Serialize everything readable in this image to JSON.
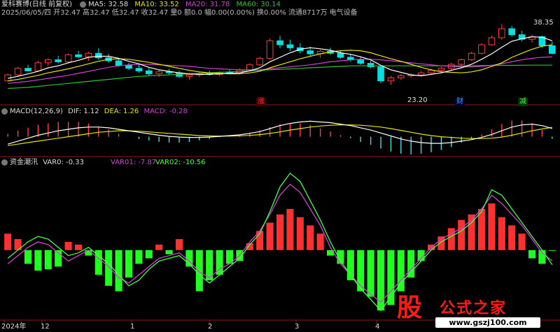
{
  "header": {
    "title": "爱科赛博(日线 前复权)",
    "ma5": "MA5: 32.58",
    "ma10": "MA10: 33.52",
    "ma20": "MA20: 31.78",
    "ma60": "MA60: 30.14",
    "info": "2025/06/05/四 开32.47 高32.47 低32.47 收32.47 量0 额0.0 幅0.00(0.00%) 换0.00% 流通8717万 电气设备"
  },
  "macd": {
    "title": "MACD(12,26,9)",
    "dif": "DIF: 1.12",
    "dea": "DEA: 1.26",
    "macd": "MACD: -0.28"
  },
  "fund": {
    "title": "资金潮汛",
    "var0": "VAR0: -0.33",
    "var01": "VAR01: -7.87",
    "var02": "VAR02: -10.56"
  },
  "markers": {
    "high": "38.35",
    "low": "23.20",
    "zhang": "涨",
    "cai": "财",
    "jian": "减"
  },
  "x_axis": [
    "2024年",
    "12",
    "1",
    "2",
    "3",
    "4"
  ],
  "logo": {
    "glyph": "股",
    "brand": "公式之家",
    "url": "www.gszj100.com"
  },
  "colors": {
    "up": "#ff3c3c",
    "down": "#00e0e0",
    "ma5": "#ffffff",
    "ma10": "#e6e600",
    "ma20": "#d040d0",
    "ma60": "#30c030",
    "macd_up": "#ff4040",
    "macd_down": "#40e0e0",
    "var0_pos": "#ff3030",
    "var0_neg": "#20ff20",
    "var01": "#d040d0",
    "var02": "#40ff40"
  },
  "chart_data": [
    {
      "type": "candlestick",
      "title": "爱科赛博(日线 前复权)",
      "ohlc": [
        [
          27,
          28.5,
          26.8,
          28.2
        ],
        [
          28.2,
          29.8,
          28,
          29.5
        ],
        [
          29.5,
          30.2,
          28.9,
          29.0
        ],
        [
          29.0,
          31,
          28.8,
          30.6
        ],
        [
          30.6,
          31.5,
          30,
          31.2
        ],
        [
          31.2,
          32,
          30.5,
          30.8
        ],
        [
          30.8,
          32.5,
          30.6,
          32.2
        ],
        [
          32.2,
          33,
          31.5,
          31.8
        ],
        [
          31.8,
          32.8,
          31,
          32.5
        ],
        [
          32.5,
          33.5,
          31.2,
          31.6
        ],
        [
          31.6,
          32.4,
          30.6,
          31
        ],
        [
          31,
          31.5,
          29.8,
          30.1
        ],
        [
          30.1,
          30.6,
          29.2,
          29.5
        ],
        [
          29.5,
          30.2,
          28.6,
          29
        ],
        [
          29,
          29.6,
          28,
          28.4
        ],
        [
          28.4,
          29.2,
          27.8,
          28.8
        ],
        [
          28.8,
          29.4,
          28.2,
          28.6
        ],
        [
          28.6,
          29,
          27.6,
          27.9
        ],
        [
          27.9,
          28.5,
          27.2,
          28.2
        ],
        [
          28.2,
          28.8,
          27.8,
          28.5
        ],
        [
          28.5,
          29,
          28,
          28.3
        ],
        [
          28.3,
          28.9,
          27.9,
          28.7
        ],
        [
          28.7,
          29.3,
          28.3,
          28.6
        ],
        [
          28.6,
          29.5,
          28.4,
          29.2
        ],
        [
          29.2,
          30.5,
          29,
          30.2
        ],
        [
          30.2,
          31.8,
          30,
          31.5
        ],
        [
          31.5,
          35.5,
          31.2,
          35
        ],
        [
          35,
          36,
          33.5,
          34.2
        ],
        [
          34.2,
          35.2,
          33,
          33.6
        ],
        [
          33.6,
          34.5,
          32.5,
          33
        ],
        [
          33,
          33.8,
          32,
          32.4
        ],
        [
          32.4,
          33.2,
          31.6,
          32.9
        ],
        [
          32.9,
          33.6,
          32.2,
          32.5
        ],
        [
          32.5,
          33,
          31.4,
          31.7
        ],
        [
          31.7,
          32.4,
          30.8,
          31.2
        ],
        [
          31.2,
          31.8,
          30.2,
          30.5
        ],
        [
          30.5,
          31,
          29.5,
          29.8
        ],
        [
          29.8,
          30.2,
          26.5,
          27
        ],
        [
          27,
          28,
          26.2,
          27.6
        ],
        [
          27.6,
          28.4,
          27.2,
          28
        ],
        [
          28,
          28.5,
          27.6,
          28.2
        ],
        [
          28.2,
          29,
          27.9,
          28.6
        ],
        [
          28.6,
          29.4,
          28.3,
          29.1
        ],
        [
          29.1,
          29.8,
          28.8,
          29.5
        ],
        [
          29.5,
          30.6,
          29.2,
          30.3
        ],
        [
          30.3,
          31.5,
          30,
          31.2
        ],
        [
          31.2,
          32.8,
          31,
          32.5
        ],
        [
          32.5,
          34.5,
          32.3,
          34.2
        ],
        [
          34.2,
          36,
          34,
          35.6
        ],
        [
          35.6,
          38.35,
          35.2,
          37.4
        ],
        [
          37.4,
          38,
          35.8,
          36.2
        ],
        [
          36.2,
          37,
          34.8,
          35.3
        ],
        [
          35.3,
          36.2,
          34.6,
          35.8
        ],
        [
          35.8,
          36,
          33.6,
          34
        ],
        [
          34,
          34.8,
          32.3,
          32.47
        ]
      ],
      "ma5": [
        27.5,
        27.9,
        28.4,
        28.9,
        29.6,
        30,
        30.6,
        31.1,
        31.7,
        31.9,
        31.9,
        31.5,
        30.9,
        30.4,
        29.7,
        29.2,
        28.9,
        28.6,
        28.4,
        28.3,
        28.3,
        28.4,
        28.5,
        28.6,
        29,
        29.6,
        30.8,
        31.7,
        32.6,
        33.3,
        33.6,
        33.4,
        33.1,
        32.6,
        32.3,
        31.8,
        31.2,
        30.1,
        29.2,
        28.7,
        28.2,
        28,
        28.3,
        28.6,
        29.1,
        29.6,
        30.3,
        31.3,
        32.4,
        33.7,
        34.9,
        35.4,
        35.8,
        35.7,
        35
      ],
      "ma10": [
        27,
        27.3,
        27.7,
        28.1,
        28.6,
        29,
        29.4,
        29.9,
        30.4,
        30.9,
        31.3,
        31.4,
        31.3,
        31,
        30.7,
        30.3,
        29.9,
        29.5,
        29.1,
        28.8,
        28.6,
        28.5,
        28.4,
        28.4,
        28.6,
        28.9,
        29.6,
        30.2,
        30.8,
        31.4,
        31.9,
        32.4,
        32.8,
        33,
        33.1,
        33,
        32.6,
        32,
        31.4,
        30.9,
        30.3,
        29.7,
        29.2,
        28.8,
        28.7,
        28.6,
        28.8,
        29.2,
        29.9,
        30.6,
        31.7,
        32.5,
        33.3,
        33.9,
        34.2
      ],
      "ma20": [
        26.5,
        26.7,
        26.9,
        27.2,
        27.5,
        27.8,
        28.1,
        28.5,
        28.9,
        29.3,
        29.7,
        30,
        30.2,
        30.3,
        30.3,
        30.2,
        30.1,
        30,
        29.9,
        29.7,
        29.5,
        29.4,
        29.3,
        29.2,
        29.2,
        29.2,
        29.4,
        29.6,
        29.8,
        30,
        30.2,
        30.5,
        30.8,
        31,
        31.2,
        31.3,
        31.3,
        31.2,
        31,
        30.8,
        30.6,
        30.4,
        30.2,
        30,
        29.9,
        29.8,
        29.8,
        29.9,
        30.1,
        30.4,
        30.8,
        31.2,
        31.5,
        31.7,
        31.78
      ],
      "ma60": [
        25.5,
        25.6,
        25.7,
        25.9,
        26.1,
        26.3,
        26.5,
        26.7,
        26.9,
        27.1,
        27.3,
        27.5,
        27.7,
        27.9,
        28,
        28.1,
        28.2,
        28.3,
        28.4,
        28.5,
        28.6,
        28.7,
        28.8,
        28.9,
        29,
        29.1,
        29.2,
        29.3,
        29.4,
        29.5,
        29.6,
        29.7,
        29.8,
        29.9,
        30,
        30,
        30,
        30,
        30,
        30,
        30,
        30,
        30,
        30,
        30,
        30,
        30,
        30.05,
        30.1,
        30.1,
        30.1,
        30.12,
        30.13,
        30.14,
        30.14
      ],
      "ylim": [
        22.5,
        39.5
      ]
    },
    {
      "type": "line",
      "title": "MACD(12,26,9)",
      "dif": [
        -1,
        -0.6,
        -0.2,
        0.2,
        0.5,
        0.8,
        1,
        1.2,
        1.3,
        1.3,
        1.2,
        1,
        0.8,
        0.6,
        0.4,
        0.2,
        0.05,
        -0.05,
        -0.1,
        -0.1,
        -0.05,
        0.05,
        0.15,
        0.25,
        0.45,
        0.7,
        1.1,
        1.5,
        1.8,
        2,
        2.1,
        2,
        1.9,
        1.7,
        1.5,
        1.2,
        0.9,
        0.5,
        0.1,
        -0.3,
        -0.6,
        -0.8,
        -0.9,
        -0.9,
        -0.8,
        -0.6,
        -0.4,
        -0.1,
        0.3,
        0.8,
        1.3,
        1.6,
        1.7,
        1.5,
        1.12
      ],
      "dea": [
        -1.2,
        -1,
        -0.8,
        -0.6,
        -0.4,
        -0.2,
        0,
        0.2,
        0.4,
        0.6,
        0.7,
        0.8,
        0.8,
        0.75,
        0.65,
        0.55,
        0.45,
        0.35,
        0.25,
        0.15,
        0.1,
        0.08,
        0.09,
        0.12,
        0.18,
        0.28,
        0.45,
        0.65,
        0.9,
        1.1,
        1.3,
        1.45,
        1.55,
        1.6,
        1.6,
        1.55,
        1.45,
        1.3,
        1.1,
        0.85,
        0.6,
        0.35,
        0.15,
        0,
        -0.1,
        -0.2,
        -0.25,
        -0.25,
        -0.2,
        -0.05,
        0.2,
        0.5,
        0.8,
        1.05,
        1.26
      ],
      "ylim": [
        -2.5,
        2.8
      ]
    },
    {
      "type": "bar+line",
      "title": "资金潮汛",
      "var0": [
        12,
        8,
        -10,
        -15,
        -14,
        -12,
        6,
        4,
        -4,
        -18,
        -26,
        -30,
        -20,
        -10,
        -6,
        4,
        -3,
        8,
        -12,
        -30,
        -22,
        -18,
        -10,
        -8,
        5,
        14,
        20,
        26,
        30,
        24,
        18,
        12,
        -4,
        -10,
        -22,
        -30,
        -34,
        -44,
        -40,
        -30,
        -20,
        -8,
        4,
        10,
        16,
        22,
        26,
        30,
        34,
        24,
        18,
        12,
        -6,
        -10,
        -0.33
      ],
      "var01": [
        -10,
        -4,
        2,
        6,
        4,
        -2,
        -8,
        -4,
        0,
        -6,
        -12,
        -20,
        -24,
        -18,
        -12,
        -6,
        -4,
        -2,
        -8,
        -16,
        -20,
        -14,
        -10,
        -4,
        6,
        14,
        26,
        40,
        48,
        42,
        30,
        18,
        2,
        -10,
        -18,
        -26,
        -32,
        -38,
        -30,
        -22,
        -14,
        -6,
        2,
        8,
        12,
        16,
        22,
        30,
        40,
        34,
        26,
        18,
        8,
        -2,
        -7.87
      ],
      "var02": [
        -6,
        0,
        6,
        10,
        8,
        2,
        -4,
        -2,
        2,
        -4,
        -10,
        -18,
        -26,
        -22,
        -14,
        -8,
        -6,
        -4,
        -10,
        -18,
        -24,
        -18,
        -12,
        -6,
        4,
        12,
        28,
        46,
        56,
        50,
        36,
        22,
        6,
        -8,
        -18,
        -28,
        -36,
        -44,
        -34,
        -24,
        -16,
        -8,
        0,
        6,
        10,
        14,
        20,
        28,
        44,
        40,
        30,
        20,
        10,
        0,
        -10.56
      ],
      "ylim": [
        -50,
        60
      ]
    }
  ]
}
